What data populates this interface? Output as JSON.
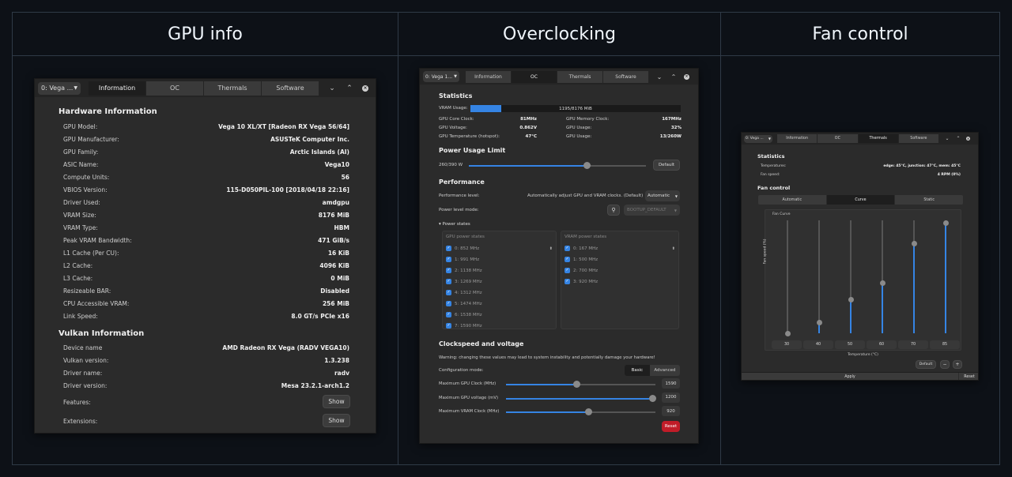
{
  "sections": {
    "gpu_info": "GPU info",
    "overclocking": "Overclocking",
    "fan_control": "Fan control"
  },
  "window1": {
    "gpu_select": "0: Vega ...",
    "tabs": [
      "Information",
      "OC",
      "Thermals",
      "Software"
    ],
    "hw_title": "Hardware Information",
    "hw": [
      {
        "k": "GPU Model:",
        "v": "Vega 10 XL/XT [Radeon RX Vega 56/64]"
      },
      {
        "k": "GPU Manufacturer:",
        "v": "ASUSTeK Computer Inc."
      },
      {
        "k": "GPU Family:",
        "v": "Arctic Islands (AI)"
      },
      {
        "k": "ASIC Name:",
        "v": "Vega10"
      },
      {
        "k": "Compute Units:",
        "v": "56"
      },
      {
        "k": "VBIOS Version:",
        "v": "115-D050PIL-100 [2018/04/18 22:16]"
      },
      {
        "k": "Driver Used:",
        "v": "amdgpu"
      },
      {
        "k": "VRAM Size:",
        "v": "8176 MiB"
      },
      {
        "k": "VRAM Type:",
        "v": "HBM"
      },
      {
        "k": "Peak VRAM Bandwidth:",
        "v": "471 GiB/s"
      },
      {
        "k": "L1 Cache (Per CU):",
        "v": "16 KiB"
      },
      {
        "k": "L2 Cache:",
        "v": "4096 KiB"
      },
      {
        "k": "L3 Cache:",
        "v": "0 MiB"
      },
      {
        "k": "Resizeable BAR:",
        "v": "Disabled"
      },
      {
        "k": "CPU Accessible VRAM:",
        "v": "256 MiB"
      },
      {
        "k": "Link Speed:",
        "v": "8.0 GT/s PCIe x16"
      }
    ],
    "vk_title": "Vulkan Information",
    "vk": [
      {
        "k": "Device name",
        "v": "AMD Radeon RX Vega (RADV VEGA10)"
      },
      {
        "k": "Vulkan version:",
        "v": "1.3.238"
      },
      {
        "k": "Driver name:",
        "v": "radv"
      },
      {
        "k": "Driver version:",
        "v": "Mesa 23.2.1-arch1.2"
      }
    ],
    "features": "Features:",
    "extensions": "Extensions:",
    "show": "Show"
  },
  "window2": {
    "gpu_select": "0: Vega 1...",
    "tabs": [
      "Information",
      "OC",
      "Thermals",
      "Software"
    ],
    "stats_title": "Statistics",
    "vram_label": "VRAM Usage:",
    "vram_text": "1195/8176 MiB",
    "vram_fraction": 0.146,
    "stats_left": [
      {
        "k": "GPU Core Clock:",
        "v": "81MHz"
      },
      {
        "k": "GPU Voltage:",
        "v": "0.862V"
      },
      {
        "k": "GPU Temperature (hotspot):",
        "v": "47°C"
      }
    ],
    "stats_right": [
      {
        "k": "GPU Memory Clock:",
        "v": "167MHz"
      },
      {
        "k": "GPU Usage:",
        "v": "32%"
      },
      {
        "k": "GPU Usage:",
        "v": "13/260W"
      }
    ],
    "power_title": "Power Usage Limit",
    "power_text": "260/390 W",
    "power_fraction": 0.667,
    "default": "Default",
    "perf_title": "Performance",
    "perf_level_label": "Performance level:",
    "perf_level_desc": "Automatically adjust GPU and VRAM clocks. (Default)",
    "perf_level_value": "Automatic",
    "power_mode_label": "Power level mode:",
    "power_mode_value": "BOOTUP_DEFAULT",
    "power_states": "Power states",
    "gpu_states_title": "GPU power states",
    "gpu_states": [
      "0: 852 MHz",
      "1: 991 MHz",
      "2: 1138 MHz",
      "3: 1269 MHz",
      "4: 1312 MHz",
      "5: 1474 MHz",
      "6: 1538 MHz",
      "7: 1590 MHz"
    ],
    "vram_states_title": "VRAM power states",
    "vram_states": [
      "0: 167 MHz",
      "1: 500 MHz",
      "2: 700 MHz",
      "3: 920 MHz"
    ],
    "clock_title": "Clockspeed and voltage",
    "warning": "Warning: changing these values may lead to system instability and potentially damage your hardware!",
    "config_label": "Configuration mode:",
    "basic": "Basic",
    "advanced": "Advanced",
    "sliders": [
      {
        "label": "Maximum GPU Clock (MHz)",
        "value": "1590",
        "fraction": 0.47
      },
      {
        "label": "Maximum GPU voltage (mV)",
        "value": "1200",
        "fraction": 0.98
      },
      {
        "label": "Maximum VRAM Clock (MHz)",
        "value": "920",
        "fraction": 0.55
      }
    ],
    "reset": "Reset"
  },
  "window3": {
    "gpu_select": "0: Vega ...",
    "tabs": [
      "Information",
      "OC",
      "Thermals",
      "Software"
    ],
    "stats_title": "Statistics",
    "temps_label": "Temperatures:",
    "temps_value": "edge: 45°C, junction: 47°C, mem: 45°C",
    "fan_label": "Fan speed:",
    "fan_value": "4 RPM (0%)",
    "fan_title": "Fan control",
    "modes": [
      "Automatic",
      "Curve",
      "Static"
    ],
    "curve_title": "Fan Curve",
    "ylabel": "Fan speed (%)",
    "xlabel": "Temperature (°C)",
    "temps": [
      "30",
      "40",
      "50",
      "60",
      "70",
      "85"
    ],
    "speeds": [
      0,
      10,
      30,
      45,
      80,
      98
    ],
    "default": "Default",
    "minus": "−",
    "plus": "+",
    "apply": "Apply",
    "reset": "Reset"
  },
  "colors": {
    "accent": "#3584e4",
    "danger": "#c01c28",
    "bg": "#0d1117",
    "window": "#2b2b2b"
  }
}
